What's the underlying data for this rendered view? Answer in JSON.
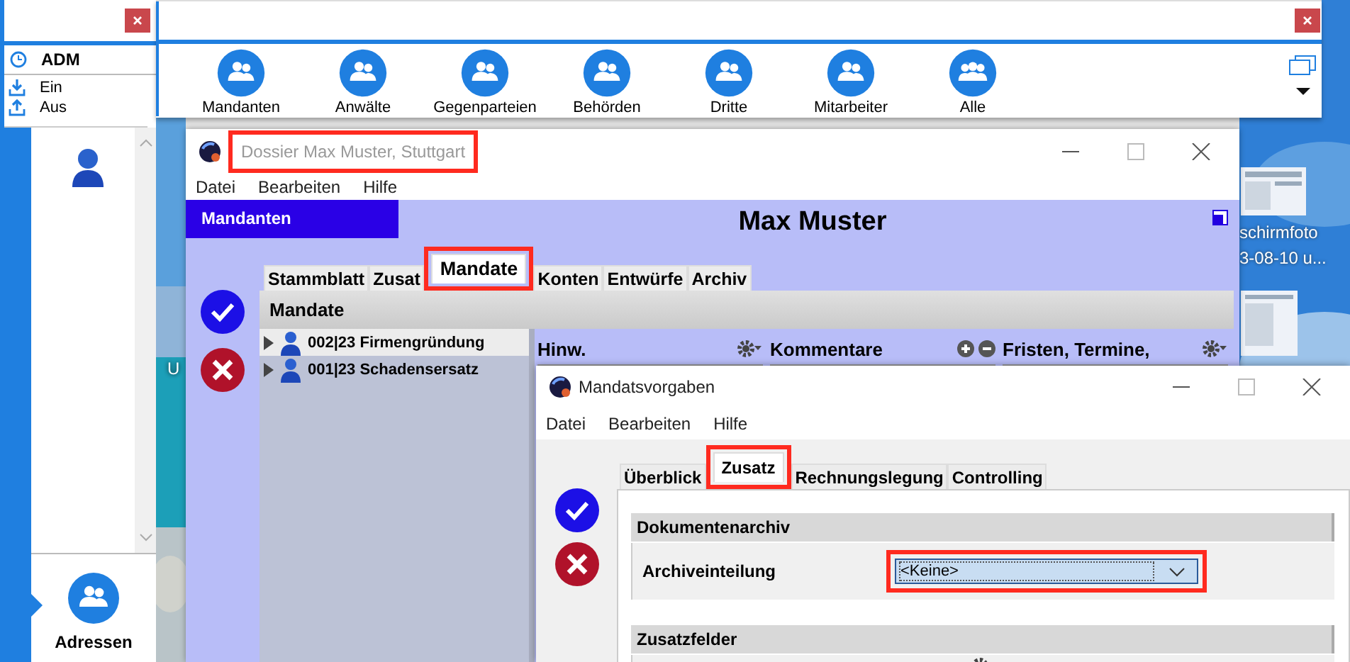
{
  "desktop": {
    "icons": [
      {
        "lines": [
          "U"
        ]
      },
      {
        "lines": [
          "schirmfoto",
          "3-08-10 u..."
        ]
      }
    ]
  },
  "left_panel": {
    "user": "ADM",
    "actions": [
      {
        "label": "Ein",
        "kind": "in"
      },
      {
        "label": "Aus",
        "kind": "out"
      }
    ],
    "nav": [
      {
        "label": "Adressen",
        "selected": true
      }
    ]
  },
  "toolbar": {
    "buttons": [
      {
        "label": "Mandanten",
        "kind": "pair"
      },
      {
        "label": "Anwälte",
        "kind": "pair"
      },
      {
        "label": "Gegenparteien",
        "kind": "pair"
      },
      {
        "label": "Behörden",
        "kind": "pair"
      },
      {
        "label": "Dritte",
        "kind": "pair"
      },
      {
        "label": "Mitarbeiter",
        "kind": "pair"
      },
      {
        "label": "Alle",
        "kind": "group"
      }
    ]
  },
  "dossier": {
    "title": "Dossier Max Muster, Stuttgart",
    "highlighted": true,
    "menu": [
      "Datei",
      "Bearbeiten",
      "Hilfe"
    ],
    "section": "Mandanten",
    "name": "Max Muster",
    "tabs": [
      {
        "label": "Stammblatt",
        "selected": false,
        "highlighted": false
      },
      {
        "label": "Zusat",
        "selected": false,
        "highlighted": false
      },
      {
        "label": "Mandate",
        "selected": true,
        "highlighted": true
      },
      {
        "label": "Konten",
        "selected": false,
        "highlighted": false
      },
      {
        "label": "Entwürfe",
        "selected": false,
        "highlighted": false
      },
      {
        "label": "Archiv",
        "selected": false,
        "highlighted": false
      }
    ],
    "heading": "Mandate",
    "tree": [
      {
        "label": "002|23 Firmengründung",
        "selected": true
      },
      {
        "label": "001|23 Schadensersatz",
        "selected": false
      }
    ],
    "columns": [
      {
        "label": "Hinw.",
        "kind": "gear"
      },
      {
        "label": "Kommentare",
        "kind": "plusminus"
      },
      {
        "label": "Fristen, Termine,",
        "kind": "gear"
      }
    ]
  },
  "dialog": {
    "title": "Mandatsvorgaben",
    "menu": [
      "Datei",
      "Bearbeiten",
      "Hilfe"
    ],
    "tabs": [
      {
        "label": "Überblick",
        "selected": false,
        "highlighted": false
      },
      {
        "label": "Zusatz",
        "selected": true,
        "highlighted": true
      },
      {
        "label": "Rechnungslegung",
        "selected": false,
        "highlighted": false
      },
      {
        "label": "Controlling",
        "selected": false,
        "highlighted": false
      }
    ],
    "groups": [
      {
        "title": "Dokumentenarchiv",
        "fields": [
          {
            "label": "Archiveinteilung",
            "value": "<Keine>",
            "highlighted": true
          }
        ]
      },
      {
        "title": "Zusatzfelder"
      }
    ]
  }
}
